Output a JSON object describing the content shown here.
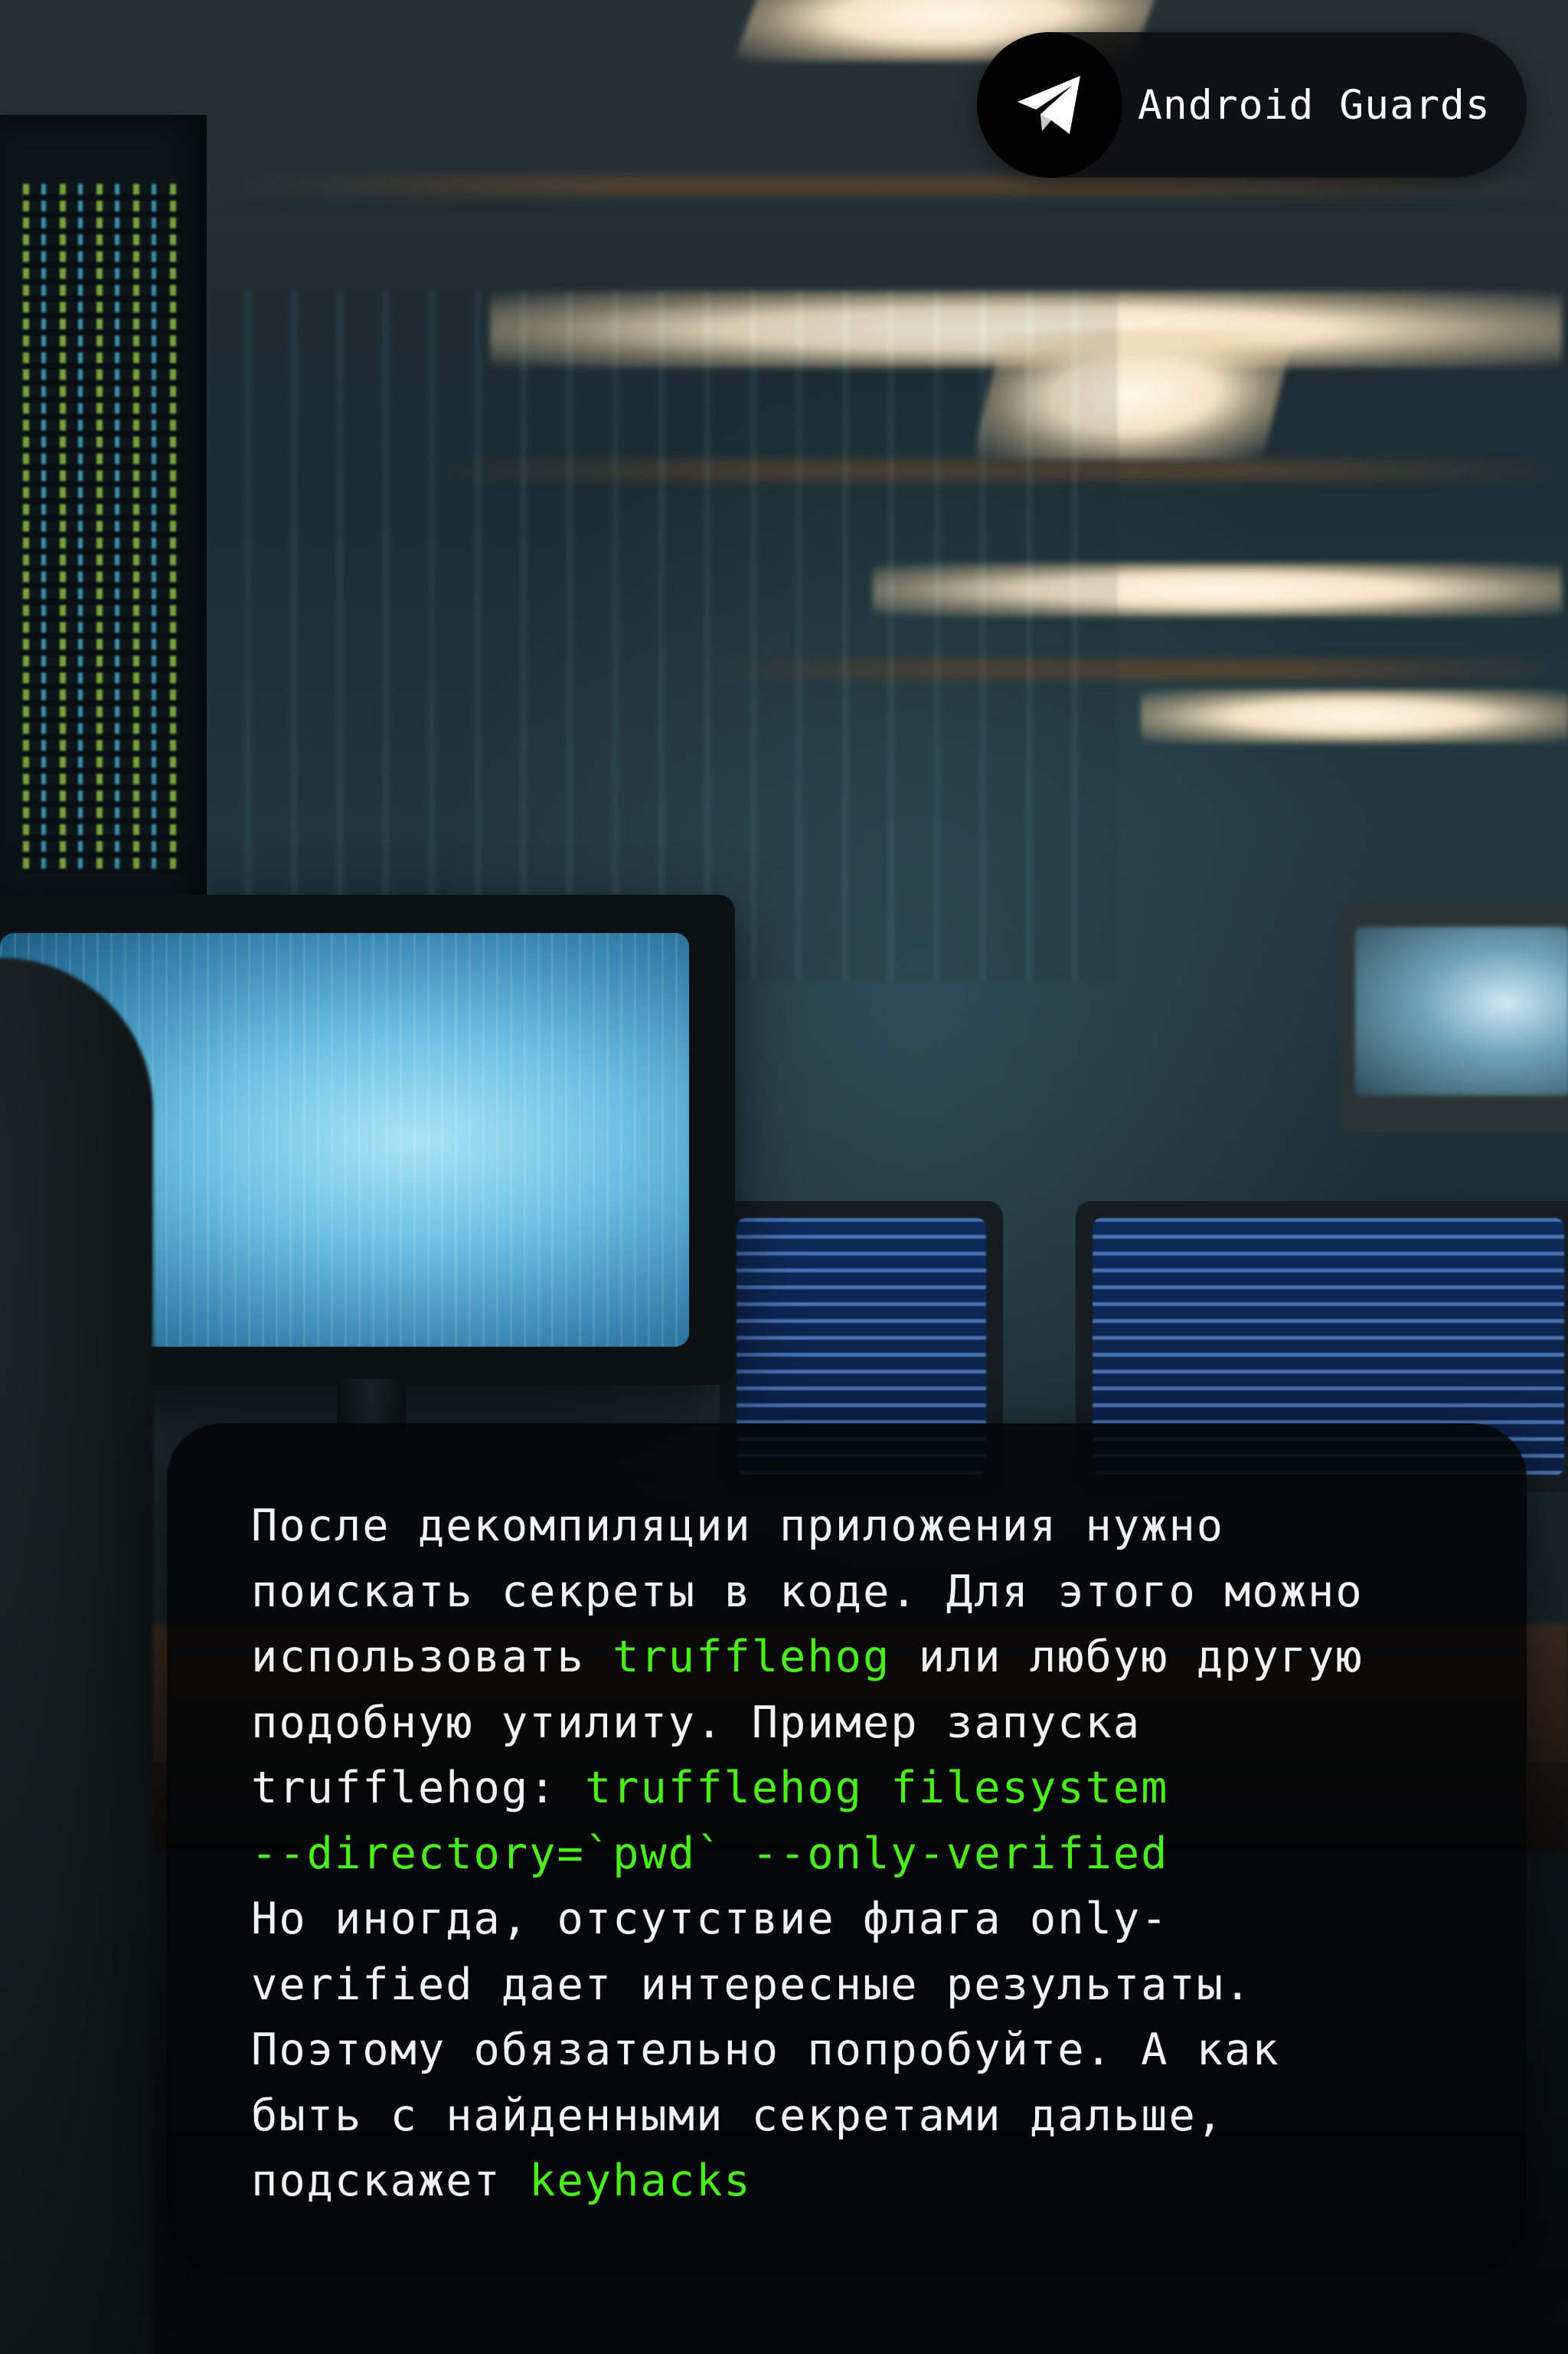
{
  "badge": {
    "title": "Android Guards",
    "icon": "telegram-paper-plane-icon"
  },
  "card": {
    "lines": [
      [
        {
          "text": "После декомпиляции приложения нужно"
        }
      ],
      [
        {
          "text": "поискать секреты в коде. Для этого можно"
        }
      ],
      [
        {
          "text": "использовать "
        },
        {
          "text": "trufflehog",
          "highlight": true
        },
        {
          "text": " или любую другую"
        }
      ],
      [
        {
          "text": "подобную утилиту. Пример запуска"
        }
      ],
      [
        {
          "text": "trufflehog: "
        },
        {
          "text": "trufflehog filesystem",
          "highlight": true
        }
      ],
      [
        {
          "text": "--directory=`pwd` --only-verified",
          "highlight": true
        }
      ],
      [
        {
          "text": "Но иногда, отсутствие флага only-"
        }
      ],
      [
        {
          "text": "verified дает интересные результаты."
        }
      ],
      [
        {
          "text": "Поэтому обязательно попробуйте. А как"
        }
      ],
      [
        {
          "text": "быть с найденными секретами дальше,"
        }
      ],
      [
        {
          "text": "подскажет "
        },
        {
          "text": "keyhacks",
          "highlight": true
        }
      ]
    ]
  },
  "colors": {
    "highlight": "#49ee1b",
    "text": "#f2f2f2",
    "card_background": "#040506",
    "badge_background": "#0c0e0f"
  }
}
